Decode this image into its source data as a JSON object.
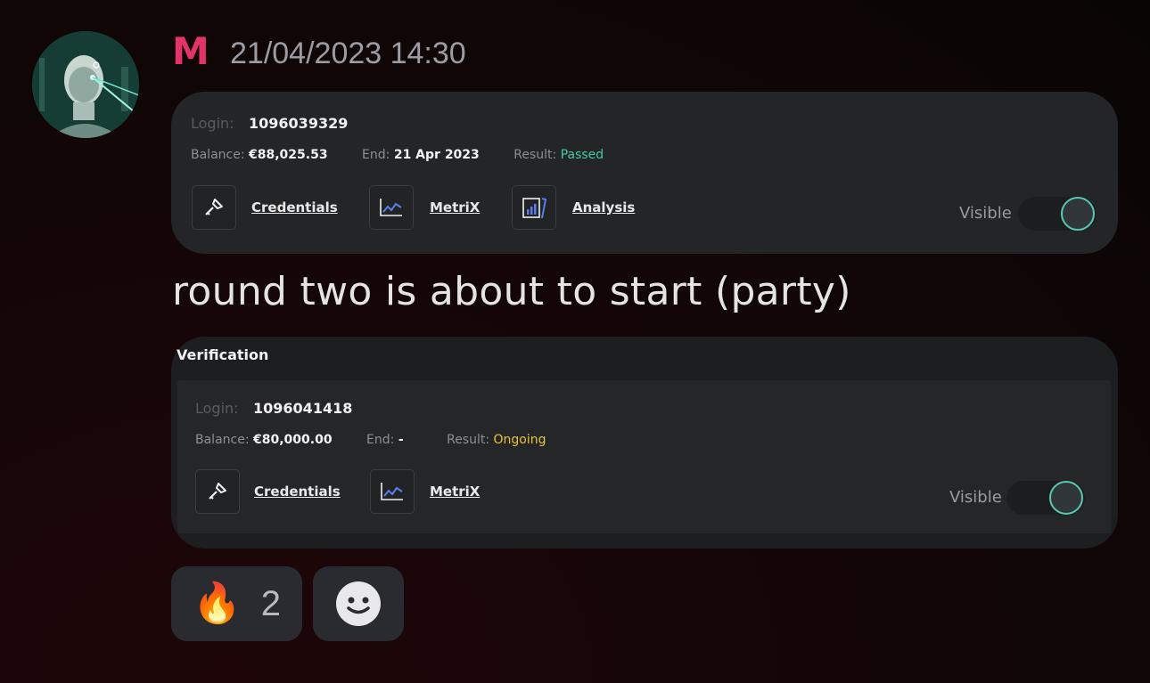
{
  "message": {
    "author_initial": "M",
    "timestamp": "21/04/2023 14:30",
    "text": "round two is about to start (party)"
  },
  "cards": [
    {
      "title": "",
      "login_label": "Login:",
      "login": "1096039329",
      "balance_label": "Balance:",
      "balance": "€88,025.53",
      "end_label": "End:",
      "end": "21 Apr 2023",
      "result_label": "Result:",
      "result": "Passed",
      "result_color": "#47c8a8",
      "actions": [
        {
          "label": "Credentials",
          "icon": "key-icon"
        },
        {
          "label": "MetriX",
          "icon": "line-chart-icon"
        },
        {
          "label": "Analysis",
          "icon": "report-icon"
        }
      ],
      "visible_label": "Visible",
      "visible": true
    },
    {
      "title": "Verification",
      "login_label": "Login:",
      "login": "1096041418",
      "balance_label": "Balance:",
      "balance": "€80,000.00",
      "end_label": "End:",
      "end": "-",
      "result_label": "Result:",
      "result": "Ongoing",
      "result_color": "#e9c23a",
      "actions": [
        {
          "label": "Credentials",
          "icon": "key-icon"
        },
        {
          "label": "MetriX",
          "icon": "line-chart-icon"
        }
      ],
      "visible_label": "Visible",
      "visible": true
    }
  ],
  "reactions": [
    {
      "emoji": "🔥",
      "icon": "fire-icon",
      "count": "2"
    },
    {
      "icon": "add-reaction-icon"
    }
  ],
  "colors": {
    "author": "#e2336a",
    "toggle_accent": "#56c8b4",
    "chart_icon_accent": "#5b7cf0"
  }
}
